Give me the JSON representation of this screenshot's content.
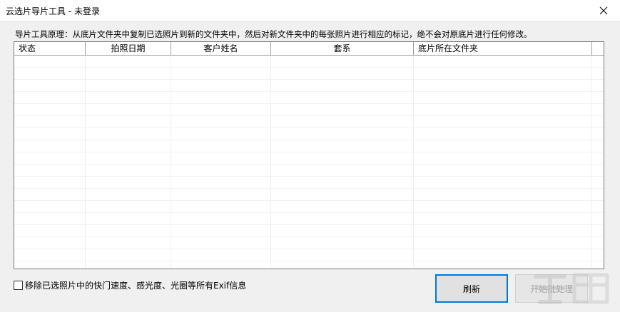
{
  "window": {
    "title": "云选片导片工具 - 未登录"
  },
  "description": "导片工具原理：从底片文件夹中复制已选照片到新的文件夹中，然后对新文件夹中的每张照片进行相应的标记，绝不会对原底片进行任何修改。",
  "table": {
    "columns": [
      "状态",
      "拍照日期",
      "客户姓名",
      "套系",
      "底片所在文件夹"
    ],
    "rows": []
  },
  "options": {
    "remove_exif_label": "移除已选照片中的快门速度、感光度、光圈等所有Exif信息",
    "remove_exif_checked": false
  },
  "buttons": {
    "refresh": "刷新",
    "start": "开始批处理"
  },
  "icons": {
    "close": "close-icon",
    "checkbox": "checkbox-icon",
    "watermark": "download-site-watermark"
  }
}
